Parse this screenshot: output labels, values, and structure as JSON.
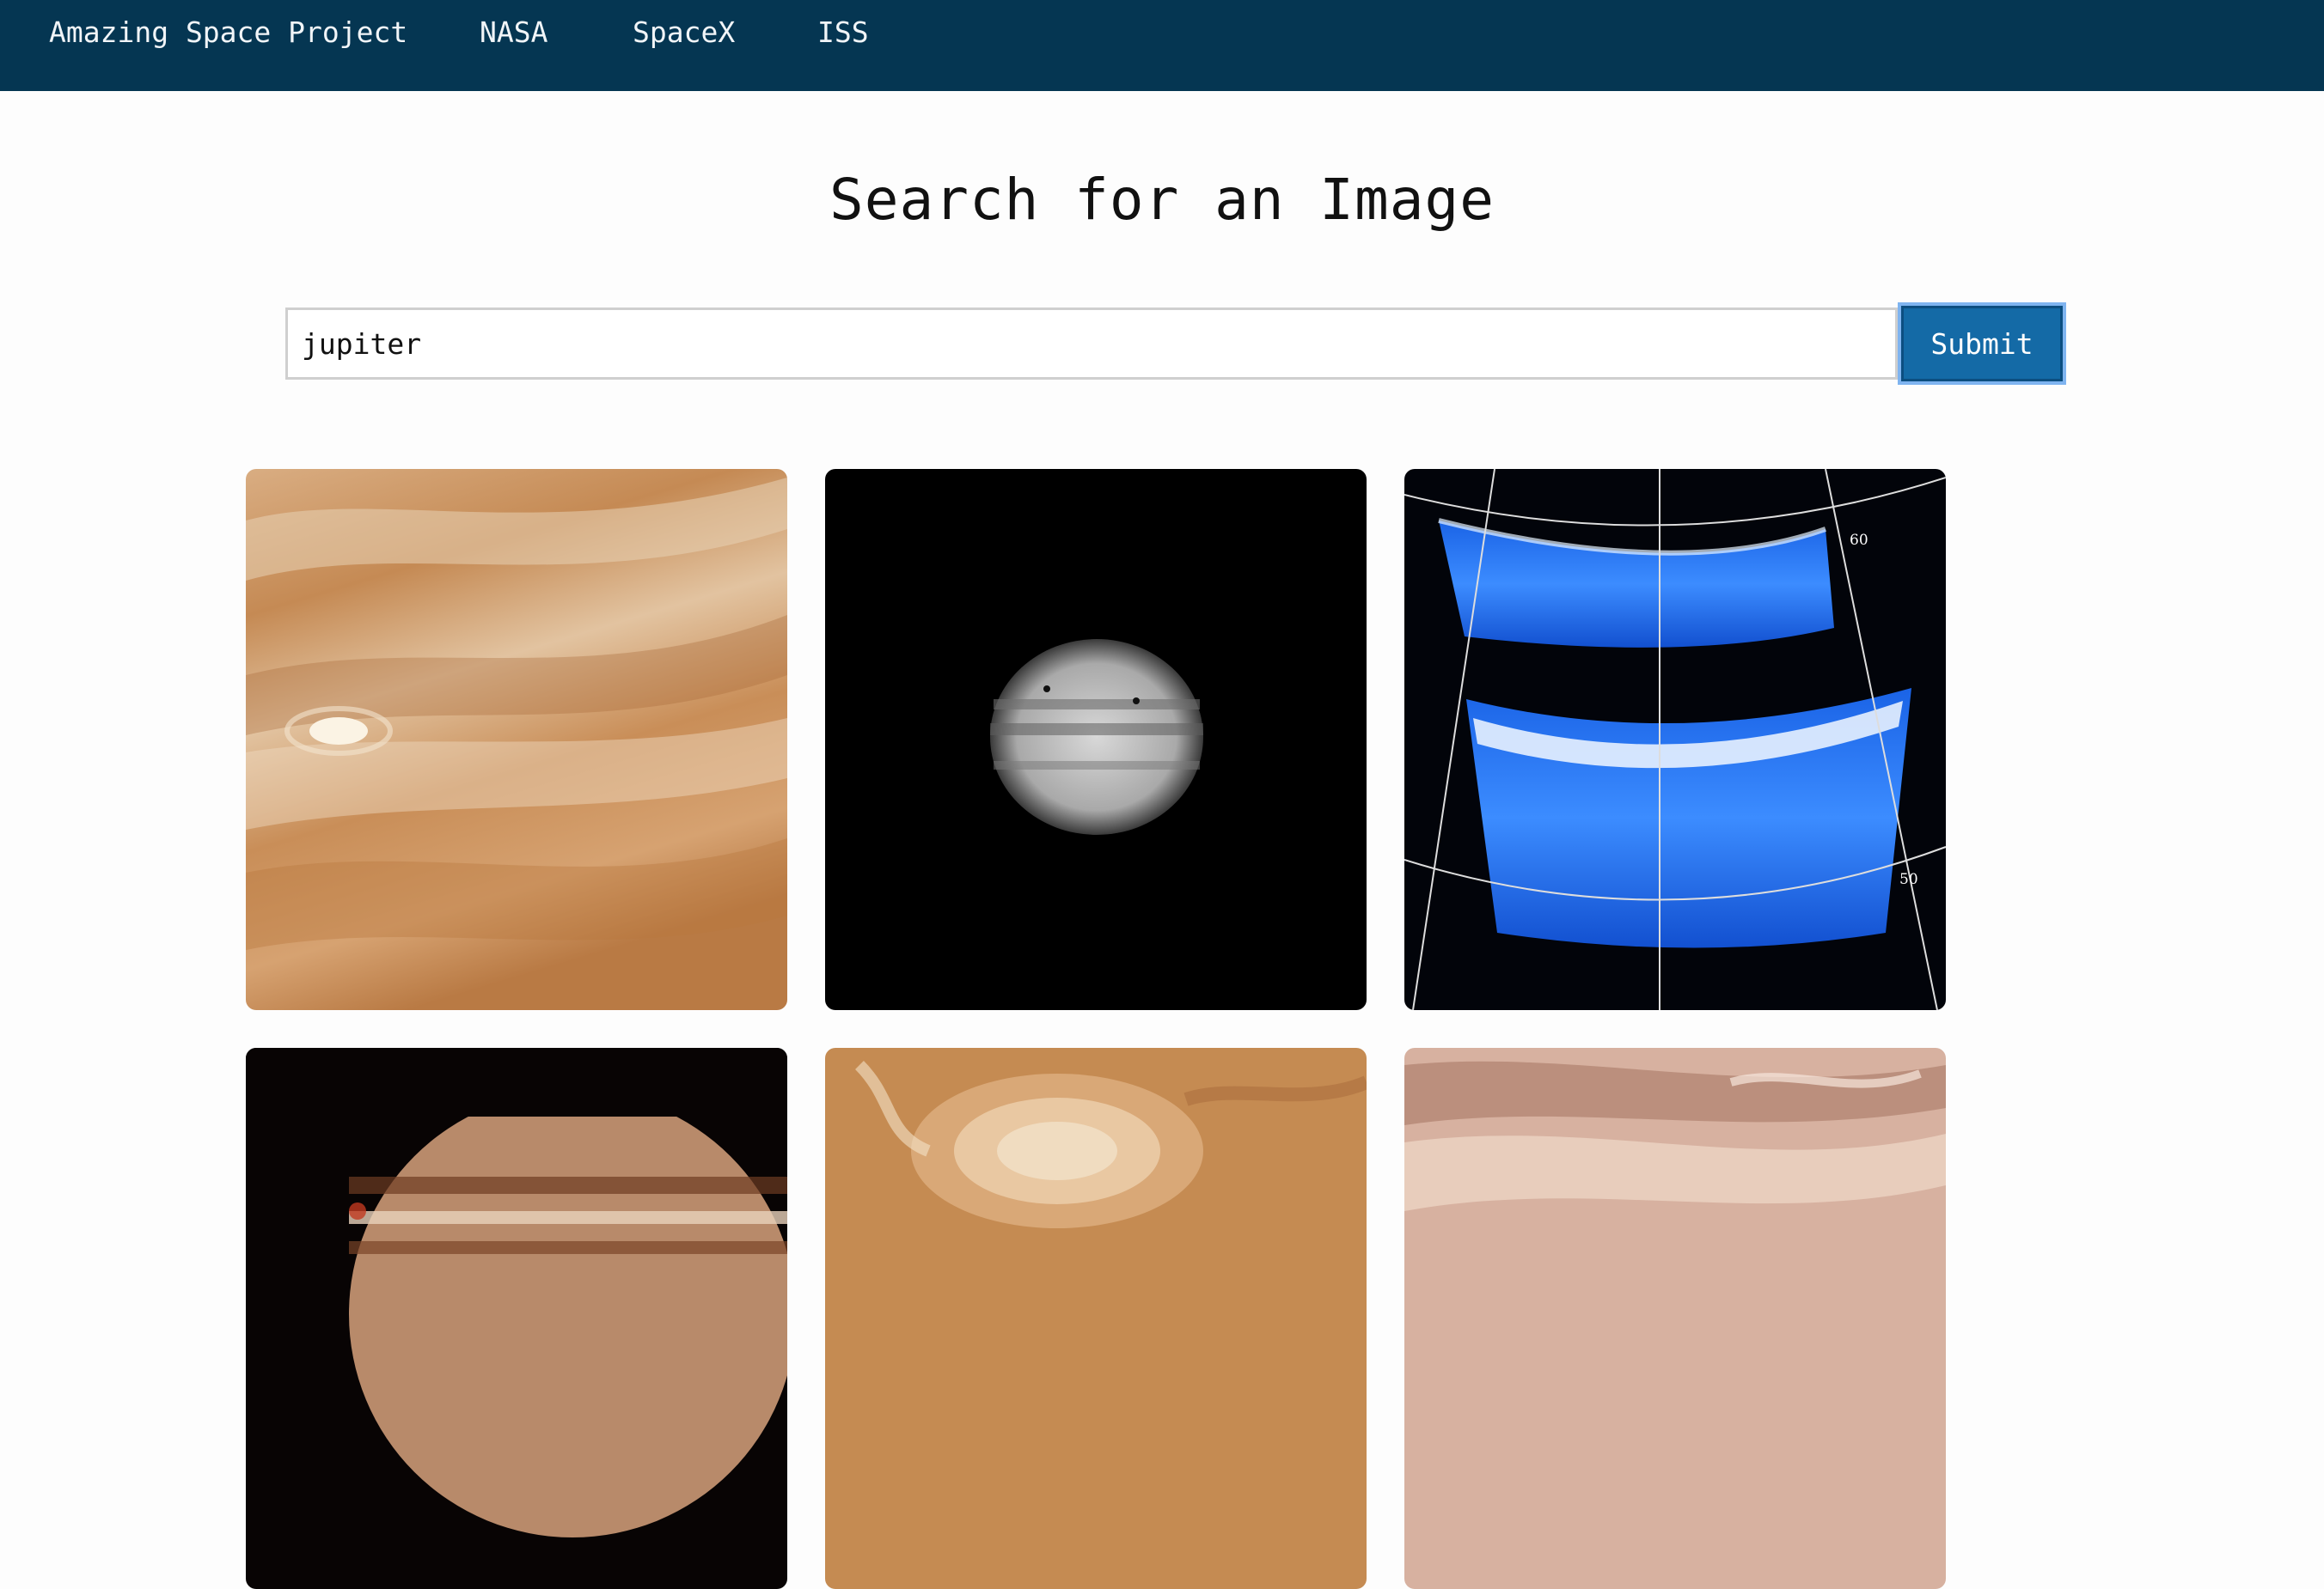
{
  "nav": {
    "brand": "Amazing Space Project",
    "links": [
      "NASA",
      "SpaceX",
      "ISS"
    ]
  },
  "page": {
    "title": "Search for an Image"
  },
  "search": {
    "value": "jupiter",
    "submit_label": "Submit"
  },
  "results": [
    {
      "subject": "jupiter-clouds-closeup"
    },
    {
      "subject": "jupiter-grayscale-disk"
    },
    {
      "subject": "jupiter-uv-aurora-map",
      "grid_labels": [
        "60",
        "50"
      ]
    },
    {
      "subject": "jupiter-with-moon"
    },
    {
      "subject": "great-red-spot"
    },
    {
      "subject": "jupiter-pink-bands"
    }
  ],
  "colors": {
    "navbar": "#053652",
    "button": "#146aa6",
    "button_focus_ring": "#7fb4f0"
  }
}
